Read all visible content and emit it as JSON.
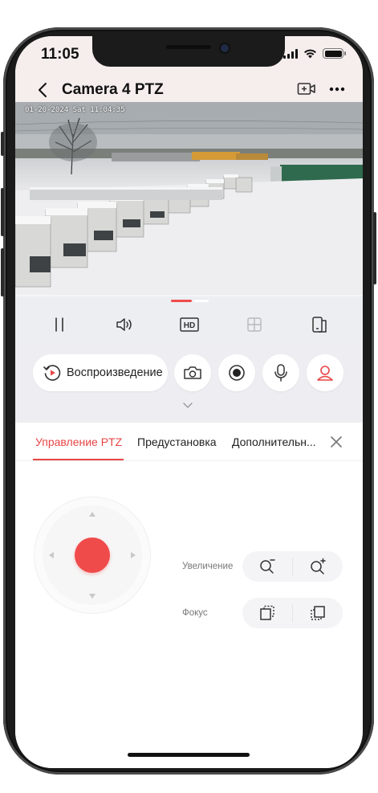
{
  "status_bar": {
    "time": "11:05"
  },
  "nav": {
    "title": "Camera 4 PTZ"
  },
  "video": {
    "osd_text": "01-20-2024 Sat 11:04:35"
  },
  "controls": {
    "playback_label": "Воспроизведение"
  },
  "tabs": [
    {
      "label": "Управление PTZ",
      "active": true
    },
    {
      "label": "Предустановка",
      "active": false
    },
    {
      "label": "Дополнительн...",
      "active": false
    }
  ],
  "ptz": {
    "zoom_label": "Увеличение",
    "focus_label": "Фокус"
  },
  "colors": {
    "accent": "#e84545",
    "knob": "#f04b4b"
  },
  "icons": [
    "back-chevron",
    "add-camera",
    "more-dots",
    "pause",
    "volume",
    "hd",
    "grid",
    "split-screen",
    "playback",
    "camera",
    "record",
    "microphone",
    "person",
    "zoom-out",
    "zoom-in",
    "focus-near",
    "focus-far"
  ]
}
